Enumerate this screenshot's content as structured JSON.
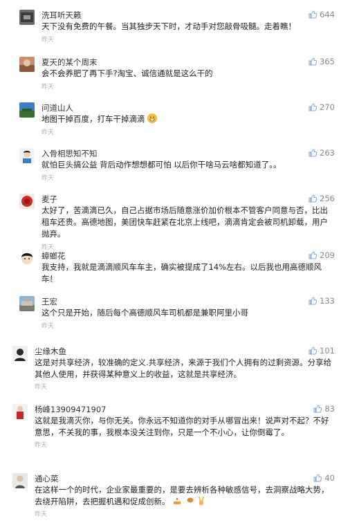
{
  "comments": [
    {
      "user": "洗耳听天籁",
      "likes": "644",
      "text": "天下没有免费的午餐。当其独步天下时，才动手对您敲骨吸髓。走着瞧！",
      "time": "昨天"
    },
    {
      "user": "夏天的某个周末",
      "likes": "365",
      "text": "会不会养肥了再下手?淘宝、诚信通就是这么干的",
      "time": "昨天"
    },
    {
      "user": "问道山人",
      "likes": "270",
      "text": "地图干掉百度，打车干掉滴滴",
      "time": "昨天"
    },
    {
      "user": "入骨相思知不知",
      "likes": "263",
      "text": "就怕巨头搞公益 背后动作想想都可怕 以后你干啥马云啥都知道了。。",
      "time": "昨天"
    },
    {
      "user": "麦子",
      "likes": "256",
      "text": "太好了，苦滴滴已久，自己占据市场后随意涨价加价根本不管客户同意与否，比出租车还贵。高德地图，美团快车赶紧在北京上线吧，滴滴肯定会被司机卸载，用户抛弃。",
      "time": "昨天"
    },
    {
      "user": "蟑螂花",
      "likes": "209",
      "text": "我支持，我就是滴滴顺风车车主，确实被提成了14%左右。以后我也用高德顺风车！",
      "time": "昨天"
    },
    {
      "user": "王宏",
      "likes": "133",
      "text": "这个只是开始，随后每个高德顺风车司机都是兼职阿里小哥",
      "time": "昨天"
    },
    {
      "user": "尘缘木鱼",
      "likes": "101",
      "text": "这是对共享经济，较准确的定义.共享经济，来源于我们个人拥有的过剩资源。分享给其他人使用，并获得某种意义上的收益，这就是共享经济。",
      "time": "昨天"
    },
    {
      "user": "杨峰13909471907",
      "likes": "83",
      "text": "这就是我滴灭你，与你无关。你永远不知道你的对手从哪冒出来！说声对不起？不好意思，不关我的事，我根本没关注到你，只是一个不小心，让你倒霉了。",
      "time": "昨天"
    },
    {
      "user": "通心菜",
      "likes": "40",
      "text": "在这样一个的时代，企业家最重要的，是要去辨析各种敏感信号，去洞察战略大势，去绕开陷阱，去把握机遇和促成创新。",
      "time": "昨天"
    }
  ],
  "icons": {
    "like": "thumb-up-icon",
    "emoji_grin": "grinning-face-emoji",
    "emoji_cake": "cake-emoji",
    "emoji_chicken": "chicken-leg-emoji",
    "emoji_victory": "victory-hand-emoji"
  },
  "colors": {
    "likes": "#888888",
    "timestamp": "#b0b0b0",
    "like_icon": "#7fa6d6"
  }
}
